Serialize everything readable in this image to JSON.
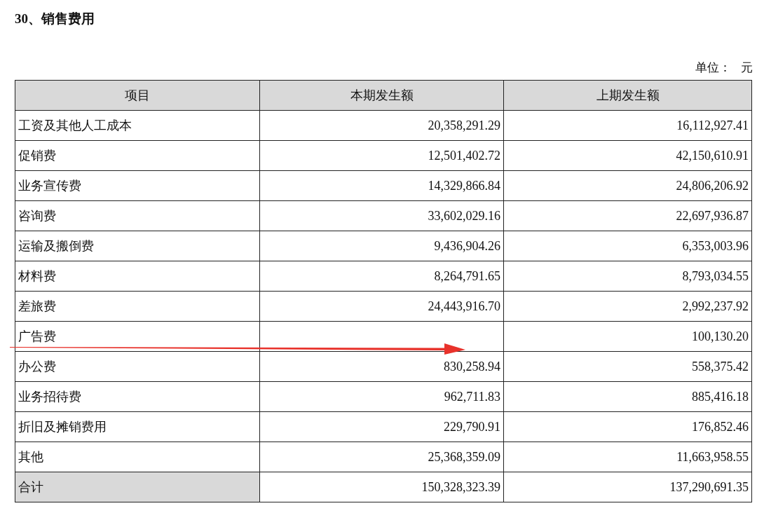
{
  "title": "30、销售费用",
  "unit": {
    "label": "单位：",
    "value": "元"
  },
  "table": {
    "columns": [
      "项目",
      "本期发生额",
      "上期发生额"
    ],
    "rows": [
      {
        "kind": "item",
        "item": "工资及其他人工成本",
        "current": "20,358,291.29",
        "previous": "16,112,927.41"
      },
      {
        "kind": "item",
        "item": "促销费",
        "current": "12,501,402.72",
        "previous": "42,150,610.91"
      },
      {
        "kind": "item",
        "item": "业务宣传费",
        "current": "14,329,866.84",
        "previous": "24,806,206.92"
      },
      {
        "kind": "item",
        "item": "咨询费",
        "current": "33,602,029.16",
        "previous": "22,697,936.87"
      },
      {
        "kind": "item",
        "item": "运输及搬倒费",
        "current": "9,436,904.26",
        "previous": "6,353,003.96"
      },
      {
        "kind": "item",
        "item": "材料费",
        "current": "8,264,791.65",
        "previous": "8,793,034.55"
      },
      {
        "kind": "item",
        "item": "差旅费",
        "current": "24,443,916.70",
        "previous": "2,992,237.92"
      },
      {
        "kind": "item",
        "item": "广告费",
        "previous": "100,130.20"
      },
      {
        "kind": "item",
        "item": "办公费",
        "current": "830,258.94",
        "previous": "558,375.42"
      },
      {
        "kind": "item",
        "item": "业务招待费",
        "current": "962,711.83",
        "previous": "885,416.18"
      },
      {
        "kind": "item",
        "item": "折旧及摊销费用",
        "current": "229,790.91",
        "previous": "176,852.46"
      },
      {
        "kind": "item",
        "item": "其他",
        "current": "25,368,359.09",
        "previous": "11,663,958.55"
      },
      {
        "kind": "total",
        "item": "合计",
        "current": "150,328,323.39",
        "previous": "137,290,691.35"
      }
    ]
  }
}
